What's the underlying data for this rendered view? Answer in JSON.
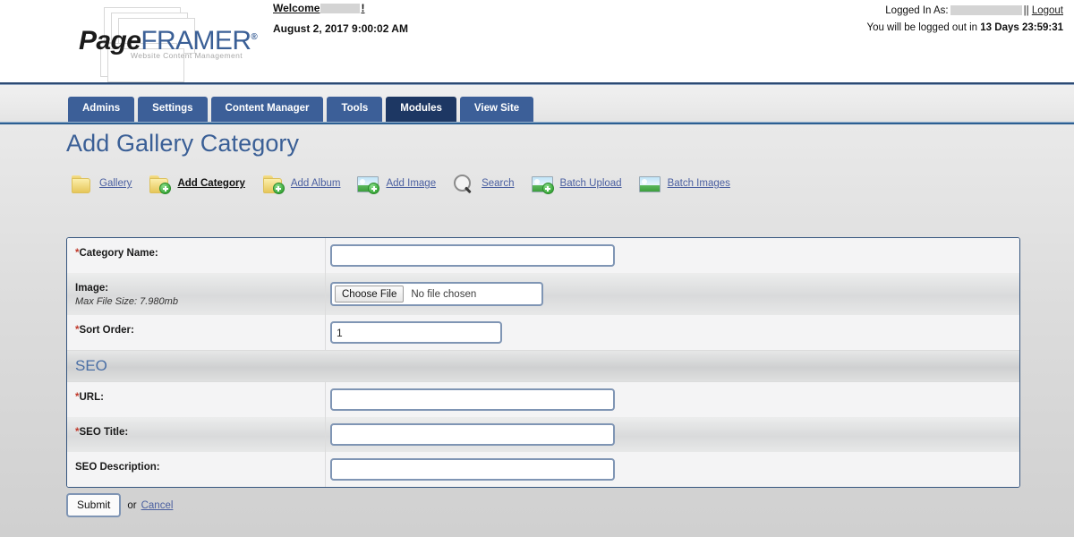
{
  "brand": {
    "logo_primary": "Page",
    "logo_secondary": "FRAMER",
    "logo_registered": "®",
    "logo_tagline": "Website Content Management"
  },
  "header": {
    "welcome_prefix": "Welcome",
    "welcome_suffix": "!",
    "datetime": "August 2, 2017 9:00:02 AM",
    "logged_in_label": "Logged In As:",
    "separator": "||",
    "logout_label": "Logout",
    "logout_notice_prefix": "You will be logged out in",
    "logout_countdown": "13 Days 23:59:31"
  },
  "nav": {
    "tabs": [
      {
        "label": "Admins",
        "active": false
      },
      {
        "label": "Settings",
        "active": false
      },
      {
        "label": "Content Manager",
        "active": false
      },
      {
        "label": "Tools",
        "active": false
      },
      {
        "label": "Modules",
        "active": true
      },
      {
        "label": "View Site",
        "active": false
      }
    ]
  },
  "page": {
    "title": "Add Gallery Category"
  },
  "toolbar": {
    "items": [
      {
        "label": "Gallery",
        "icon": "folder-icon",
        "current": false
      },
      {
        "label": "Add Category",
        "icon": "folder-add-icon",
        "current": true
      },
      {
        "label": "Add Album",
        "icon": "folder-add-icon",
        "current": false
      },
      {
        "label": "Add Image",
        "icon": "image-add-icon",
        "current": false
      },
      {
        "label": "Search",
        "icon": "search-icon",
        "current": false
      },
      {
        "label": "Batch Upload",
        "icon": "image-add-icon",
        "current": false
      },
      {
        "label": "Batch Images",
        "icon": "image-icon",
        "current": false
      }
    ]
  },
  "form": {
    "category_name": {
      "label": "Category Name:",
      "required": "*",
      "value": "",
      "placeholder": ""
    },
    "image": {
      "label": "Image:",
      "required": "",
      "sublabel": "Max File Size: 7.980mb",
      "choose_button": "Choose File",
      "file_status": "No file chosen"
    },
    "sort_order": {
      "label": "Sort Order:",
      "required": "*",
      "value": "1",
      "placeholder": ""
    },
    "seo_section_title": "SEO",
    "url": {
      "label": "URL:",
      "required": "*",
      "value": "",
      "placeholder": ""
    },
    "seo_title": {
      "label": "SEO Title:",
      "required": "*",
      "value": "",
      "placeholder": ""
    },
    "seo_description": {
      "label": "SEO Description:",
      "required": "",
      "value": "",
      "placeholder": ""
    }
  },
  "actions": {
    "submit_label": "Submit",
    "or_label": "or",
    "cancel_label": "Cancel"
  },
  "colors": {
    "brand_blue": "#3a5f96",
    "tab_blue": "#3c5f98",
    "tab_active_blue": "#1d3763",
    "link_blue": "#4a5fa0",
    "required_red": "#c0392b",
    "rule_blue": "#2c4a73"
  }
}
